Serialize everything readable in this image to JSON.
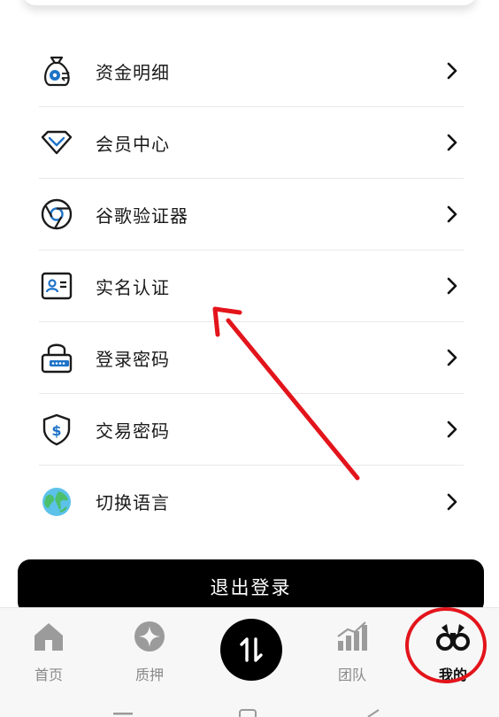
{
  "menu": {
    "items": [
      {
        "label": "资金明细",
        "icon": "money-bag-icon"
      },
      {
        "label": "会员中心",
        "icon": "diamond-icon"
      },
      {
        "label": "谷歌验证器",
        "icon": "chrome-icon"
      },
      {
        "label": "实名认证",
        "icon": "id-card-icon"
      },
      {
        "label": "登录密码",
        "icon": "padlock-icon"
      },
      {
        "label": "交易密码",
        "icon": "shield-dollar-icon"
      },
      {
        "label": "切换语言",
        "icon": "globe-icon"
      }
    ]
  },
  "logout_label": "退出登录",
  "nav": {
    "items": [
      {
        "label": "首页",
        "icon": "home-icon",
        "active": false
      },
      {
        "label": "质押",
        "icon": "star-icon",
        "active": false
      },
      {
        "label": "团队",
        "icon": "bar-chart-icon",
        "active": false
      },
      {
        "label": "我的",
        "icon": "binoculars-icon",
        "active": true
      }
    ],
    "center_icon": "swap-icon"
  },
  "colors": {
    "annotation": "#e3141b",
    "icon_blue": "#1e73c8",
    "logout_bg": "#000000"
  }
}
